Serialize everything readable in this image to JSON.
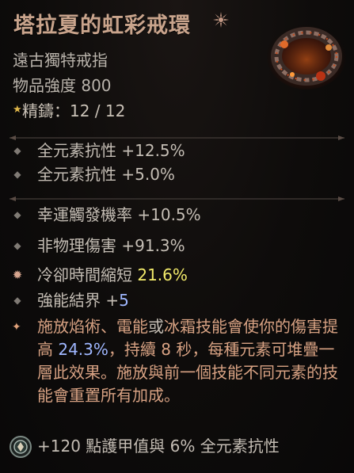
{
  "item": {
    "name": "塔拉夏的虹彩戒環",
    "type": "遠古獨特戒指",
    "item_power": "物品強度 800",
    "masterwork_label": "精鑄",
    "masterwork_value": "12 / 12"
  },
  "icons": {
    "title_mark": "unique-item-icon",
    "masterwork": "star-icon",
    "bullet": "diamond-bullet-icon",
    "greater_affix": "greater-affix-icon",
    "legendary_aspect": "aspect-sparkle-icon",
    "socket": "gem-socket-icon"
  },
  "implicit_affixes": [
    {
      "text": "全元素抗性 +12.5%"
    },
    {
      "text": "全元素抗性 +5.0%"
    }
  ],
  "affixes": [
    {
      "text": "幸運觸發機率 +10.5%"
    },
    {
      "text": "非物理傷害 +91.3%"
    },
    {
      "label": "冷卻時間縮短 ",
      "value": "21.6%"
    },
    {
      "label": "強能結界 +",
      "value": "5"
    }
  ],
  "unique_power": {
    "part1": "施放焰術、電能",
    "part2": "或",
    "part3": "冰霜",
    "part4": "技能會使你的傷害提高 ",
    "value": "24.3%",
    "part5": "，持續 8 秒，每種元素可堆疊一層此效果。施放與前一個技能不同元素的技能會重置所有加成。"
  },
  "socket": {
    "text": "+120 點護甲值與 6% 全元素抗性"
  },
  "colors": {
    "title": "#c9a48c",
    "highlight_yellow": "#f2ea6a",
    "highlight_blue": "#9fb7ff",
    "unique_text": "#d8a283"
  }
}
